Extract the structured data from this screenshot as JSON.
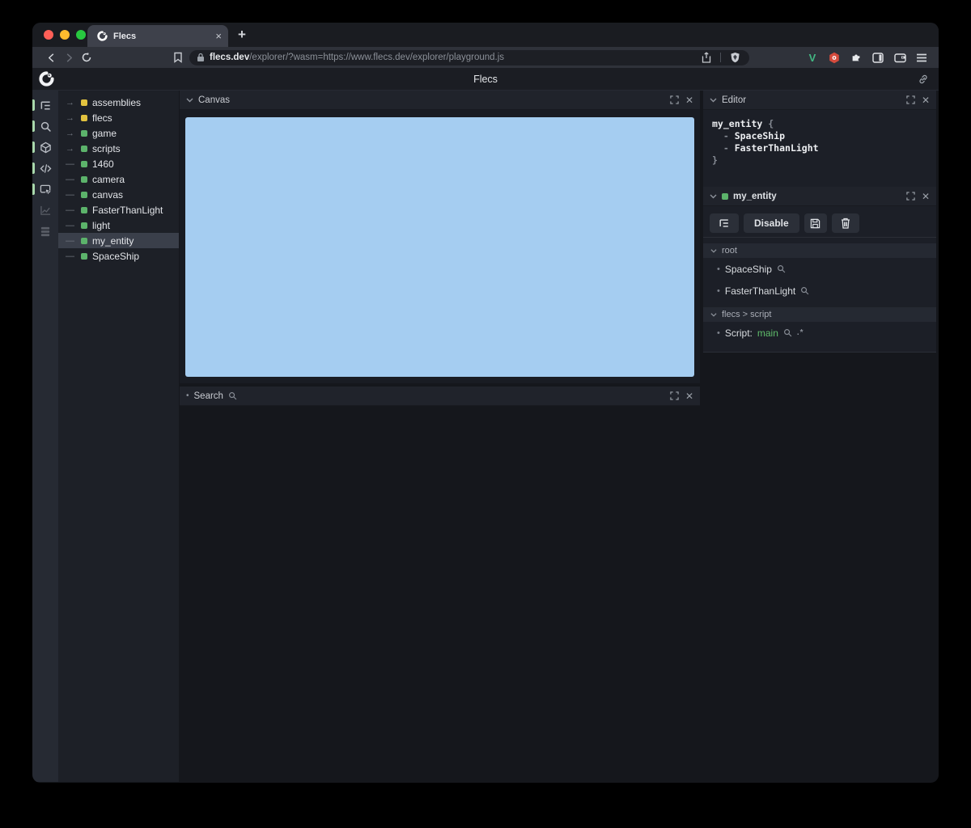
{
  "browser": {
    "traffic_lights": [
      {
        "name": "close",
        "color": "#ff5f57"
      },
      {
        "name": "minimize",
        "color": "#febc2e"
      },
      {
        "name": "maximize",
        "color": "#28c840"
      }
    ],
    "tab_title": "Flecs",
    "url_domain": "flecs.dev",
    "url_path": "/explorer/?wasm=https://www.flecs.dev/explorer/playground.js",
    "accent_vue_green": "#42b883",
    "accent_adblock_red": "#d54b3d"
  },
  "app_header": {
    "title": "Flecs"
  },
  "nav_sidebar": {
    "items": [
      {
        "name": "tree-outline-icon",
        "active": true
      },
      {
        "name": "search-icon",
        "active": true
      },
      {
        "name": "cube-icon",
        "active": true
      },
      {
        "name": "code-icon",
        "active": true
      },
      {
        "name": "inspect-icon",
        "active": true
      },
      {
        "name": "stats-chart-icon",
        "active": false
      },
      {
        "name": "journal-rows-icon",
        "active": false
      }
    ],
    "active_indicator_color": "#a9d8ac"
  },
  "tree": {
    "items": [
      {
        "label": "assemblies",
        "color": "#e2c23f",
        "expandable": true,
        "selected": false
      },
      {
        "label": "flecs",
        "color": "#e2c23f",
        "expandable": true,
        "selected": false
      },
      {
        "label": "game",
        "color": "#5cb36b",
        "expandable": true,
        "selected": false
      },
      {
        "label": "scripts",
        "color": "#5cb36b",
        "expandable": true,
        "selected": false
      },
      {
        "label": "1460",
        "color": "#5cb36b",
        "expandable": false,
        "selected": false
      },
      {
        "label": "camera",
        "color": "#5cb36b",
        "expandable": false,
        "selected": false
      },
      {
        "label": "canvas",
        "color": "#5cb36b",
        "expandable": false,
        "selected": false
      },
      {
        "label": "FasterThanLight",
        "color": "#5cb36b",
        "expandable": false,
        "selected": false
      },
      {
        "label": "light",
        "color": "#5cb36b",
        "expandable": false,
        "selected": false
      },
      {
        "label": "my_entity",
        "color": "#5cb36b",
        "expandable": false,
        "selected": true
      },
      {
        "label": "SpaceShip",
        "color": "#5cb36b",
        "expandable": false,
        "selected": false
      }
    ]
  },
  "panels": {
    "canvas": {
      "title": "Canvas",
      "canvas_color": "#a5cdf1"
    },
    "search": {
      "title": "Search"
    },
    "editor": {
      "title": "Editor",
      "code": [
        [
          {
            "text": "my_entity",
            "tone": "plain"
          },
          {
            "text": " {",
            "tone": "dim"
          }
        ],
        [
          {
            "text": "  - ",
            "tone": "dim"
          },
          {
            "text": "SpaceShip",
            "tone": "plain"
          }
        ],
        [
          {
            "text": "  - ",
            "tone": "dim"
          },
          {
            "text": "FasterThanLight",
            "tone": "plain"
          }
        ],
        [
          {
            "text": "}",
            "tone": "dim"
          }
        ]
      ]
    },
    "entity": {
      "title": "my_entity",
      "title_square_color": "#5cb36b",
      "toolbar": {
        "disable_label": "Disable"
      },
      "sections": [
        {
          "title": "root",
          "rows": [
            {
              "label": "SpaceShip"
            },
            {
              "label": "FasterThanLight"
            }
          ]
        },
        {
          "title": "flecs > script",
          "rows": [
            {
              "label": "Script:",
              "value": "main",
              "badge": ".*"
            }
          ]
        }
      ]
    }
  }
}
